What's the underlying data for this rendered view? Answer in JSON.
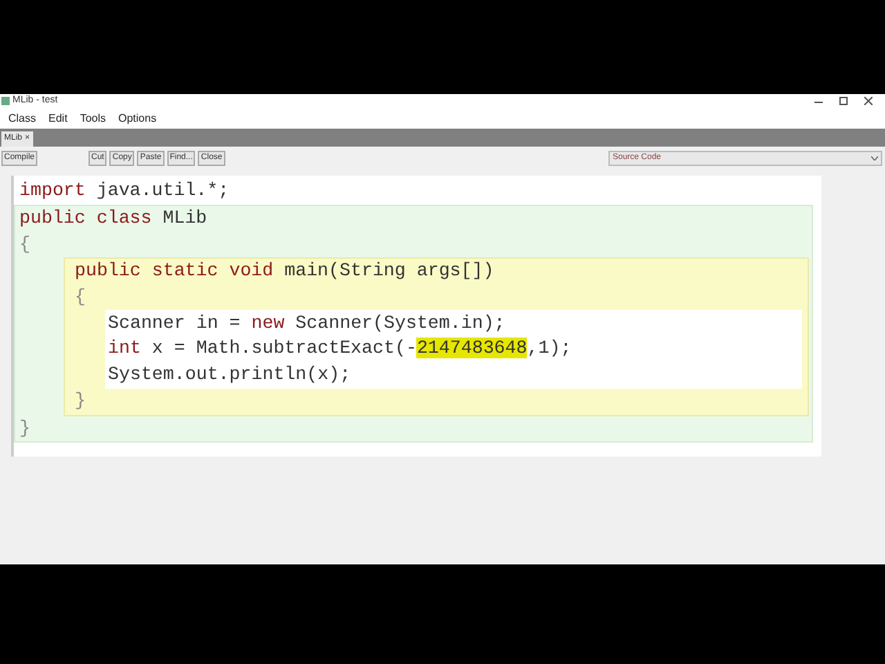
{
  "window": {
    "title": "MLib - test"
  },
  "menu": [
    "Class",
    "Edit",
    "Tools",
    "Options"
  ],
  "tabs": [
    {
      "label": "MLib",
      "close": "×",
      "selected": true
    }
  ],
  "toolbar": {
    "compile": "Compile",
    "buttons": [
      "Cut",
      "Copy",
      "Paste",
      "Find...",
      "Close"
    ],
    "view_select": {
      "value": "Source Code"
    }
  },
  "editor": {
    "lines": [
      [
        {
          "kind": "keyword",
          "text": "import"
        },
        {
          "kind": "text",
          "text": " java.util.*;"
        }
      ]
    ],
    "scope": {
      "kind": "class",
      "header": [
        {
          "kind": "keyword",
          "text": "public class"
        },
        {
          "kind": "text",
          "text": " MLib"
        }
      ],
      "open": "{",
      "close": "}",
      "scope": {
        "kind": "method",
        "header": [
          {
            "kind": "keyword",
            "text": "public static void"
          },
          {
            "kind": "text",
            "text": " main(String args[])"
          }
        ],
        "open": "{",
        "close": "}",
        "body": [
          [
            {
              "kind": "text",
              "text": "Scanner in = "
            },
            {
              "kind": "keyword",
              "text": "new"
            },
            {
              "kind": "text",
              "text": " Scanner(System.in);"
            }
          ],
          [
            {
              "kind": "keyword",
              "text": "int"
            },
            {
              "kind": "text",
              "text": " x = Math.subtractExact(-"
            },
            {
              "kind": "selected",
              "text": "2147483648"
            },
            {
              "kind": "text",
              "text": ",1);"
            }
          ],
          [
            {
              "kind": "text",
              "text": "System.out.println(x);"
            }
          ]
        ]
      }
    }
  }
}
